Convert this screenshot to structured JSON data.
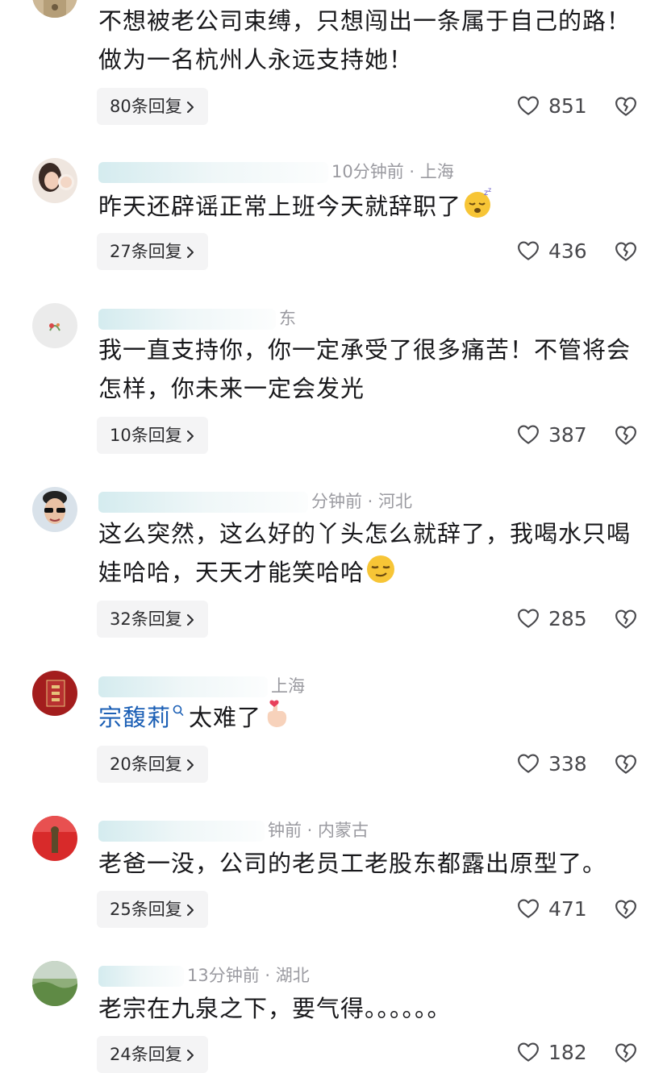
{
  "comments": [
    {
      "text": "不想被老公司束缚，只想闯出一条属于自己的路！做为一名杭州人永远支持她！",
      "replies": "80条回复",
      "likes": "851"
    },
    {
      "meta_visible": "10分钟前 · 上海",
      "text": "昨天还辟谣正常上班今天就辞职了",
      "replies": "27条回复",
      "likes": "436"
    },
    {
      "meta_visible": "东",
      "text": "我一直支持你，你一定承受了很多痛苦！不管将会怎样，你未来一定会发光",
      "replies": "10条回复",
      "likes": "387"
    },
    {
      "meta_visible": "分钟前 · 河北",
      "text": "这么突然，这么好的丫头怎么就辞了，我喝水只喝娃哈哈，天天才能笑哈哈",
      "replies": "32条回复",
      "likes": "285"
    },
    {
      "meta_visible": "上海",
      "mention": "宗馥莉",
      "text": "太难了",
      "replies": "20条回复",
      "likes": "338"
    },
    {
      "meta_visible": "钟前 · 内蒙古",
      "text": "老爸一没，公司的老员工老股东都露出原型了。",
      "replies": "25条回复",
      "likes": "471"
    },
    {
      "meta_visible": "13分钟前 · 湖北",
      "text": "老宗在九泉之下，要气得。。。。。。",
      "replies": "24条回复",
      "likes": "182"
    }
  ],
  "icons": {
    "like": "heart-outline-icon",
    "dislike": "broken-heart-icon",
    "chevron": "chevron-right-icon",
    "search": "search-icon"
  },
  "colors": {
    "text": "#18181b",
    "meta": "#9a9aa0",
    "mention": "#1b5fb5",
    "pill": "#f4f4f5"
  }
}
